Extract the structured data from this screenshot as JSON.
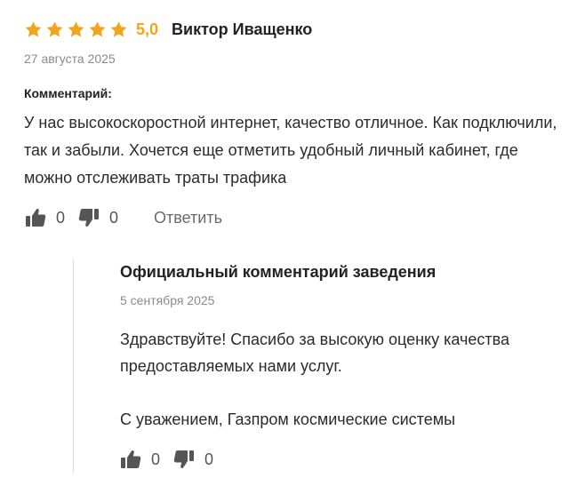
{
  "review": {
    "rating": "5,0",
    "stars_filled": 5,
    "stars_total": 5,
    "author": "Виктор Иващенко",
    "date": "27 августа 2025",
    "comment_label": "Комментарий:",
    "comment_text": "У нас высокоскоростной интернет, качество отличное. Как подключили, так и забыли. Хочется еще отметить удобный личный кабинет, где можно отслеживать траты трафика",
    "likes": "0",
    "dislikes": "0",
    "reply_label": "Ответить"
  },
  "official": {
    "title": "Официальный комментарий заведения",
    "date": "5 сентября 2025",
    "greeting": "Здравствуйте! Спасибо за высокую оценку качества предоставляемых нами услуг.",
    "signature": "С уважением, Газпром космические системы",
    "likes": "0",
    "dislikes": "0"
  },
  "colors": {
    "star": "#f5a31a",
    "icon": "#555555",
    "muted_text": "#8a8a8a",
    "divider": "#e0e0e0"
  },
  "icons": [
    "star-icon",
    "thumbs-up-icon",
    "thumbs-down-icon"
  ]
}
